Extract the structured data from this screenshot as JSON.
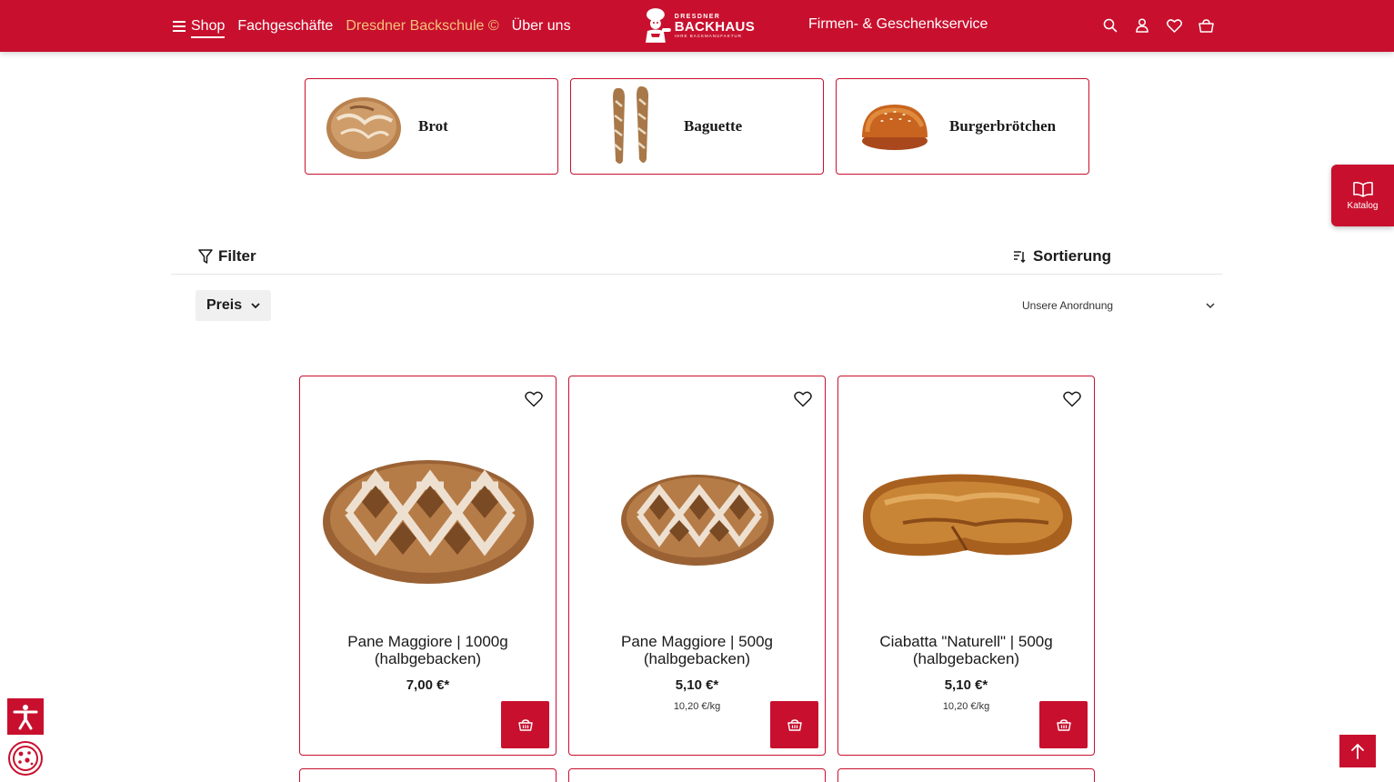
{
  "header": {
    "nav": {
      "shop_label": "Shop",
      "fachgeschaefte_label": "Fachgeschäfte",
      "backschule_label": "Dresdner Backschule ©",
      "ueber_uns_label": "Über uns"
    },
    "logo": {
      "line1": "DRESDNER",
      "line2": "BACKHAUS",
      "line3": "IHRE BACKMANUFAKTUR"
    },
    "service_label": "Firmen- & Geschenkservice",
    "icons": [
      "search-icon",
      "account-icon",
      "wishlist-icon",
      "basket-icon"
    ]
  },
  "categories": [
    {
      "label": "Brot"
    },
    {
      "label": "Baguette"
    },
    {
      "label": "Burgerbrötchen"
    }
  ],
  "katalog": {
    "label": "Katalog"
  },
  "filter": {
    "filter_label": "Filter",
    "sort_label": "Sortierung",
    "price_chip": "Preis",
    "sort_selected": "Unsere Anordnung"
  },
  "products": [
    {
      "name": "Pane Maggiore | 1000g (halbgebacken)",
      "price": "7,00 €*",
      "unit_price": ""
    },
    {
      "name": "Pane Maggiore | 500g (halbgebacken)",
      "price": "5,10 €*",
      "unit_price": "10,20 €/kg"
    },
    {
      "name": "Ciabatta \"Naturell\" | 500g (halbgebacken)",
      "price": "5,10 €*",
      "unit_price": "10,20 €/kg"
    }
  ],
  "colors": {
    "brand": "#c8102e",
    "highlight_link": "#f4c27a"
  }
}
